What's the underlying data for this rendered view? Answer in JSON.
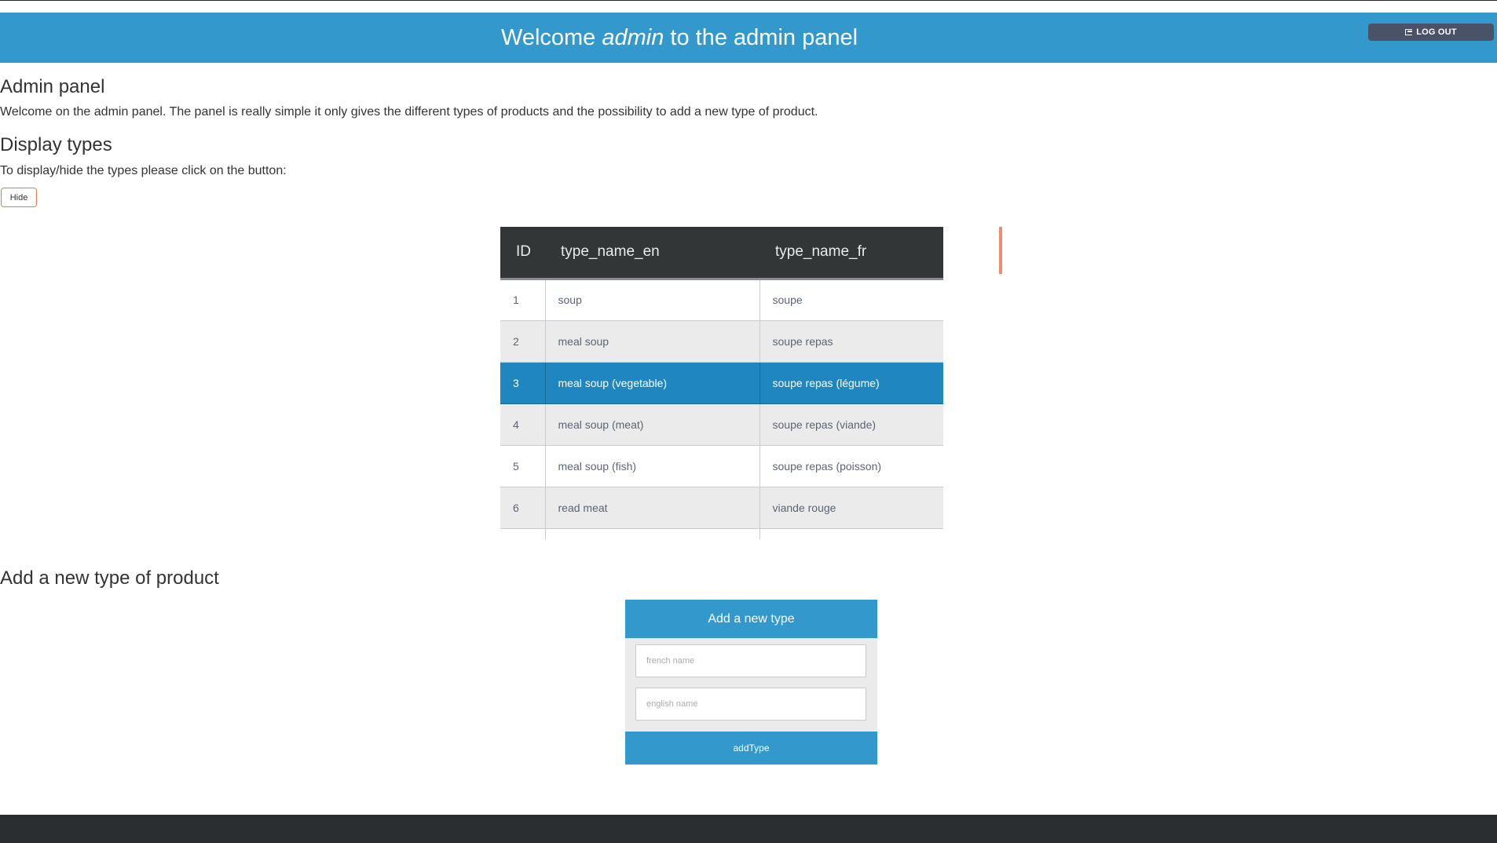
{
  "header": {
    "title_prefix": "Welcome ",
    "username": "admin",
    "title_suffix": " to the admin panel",
    "logout_label": "LOG OUT"
  },
  "intro": {
    "heading": "Admin panel",
    "text": "Welcome on the admin panel. The panel is really simple it only gives the different types of products and the possibility to add a new type of product."
  },
  "display": {
    "heading": "Display types",
    "text": "To display/hide the types please click on the button:",
    "toggle_label": "Hide"
  },
  "table": {
    "columns": [
      "ID",
      "type_name_en",
      "type_name_fr"
    ],
    "rows": [
      [
        "1",
        "soup",
        "soupe"
      ],
      [
        "2",
        "meal soup",
        "soupe repas"
      ],
      [
        "3",
        "meal soup (vegetable)",
        "soupe repas (légume)"
      ],
      [
        "4",
        "meal soup (meat)",
        "soupe repas (viande)"
      ],
      [
        "5",
        "meal soup (fish)",
        "soupe repas (poisson)"
      ],
      [
        "6",
        "read meat",
        "viande rouge"
      ]
    ],
    "selected_row": 2
  },
  "add_form": {
    "heading": "Add a new type of product",
    "card_title": "Add a new type",
    "french_placeholder": "french name",
    "english_placeholder": "english name",
    "french_value": "",
    "english_value": "",
    "submit_label": "addType"
  },
  "colors": {
    "primary": "#3399cc",
    "selected_row": "#1f86c0",
    "table_header": "#333637",
    "footer": "#2b2e31",
    "logout": "#4a5268",
    "accent": "#ec8e6b"
  }
}
